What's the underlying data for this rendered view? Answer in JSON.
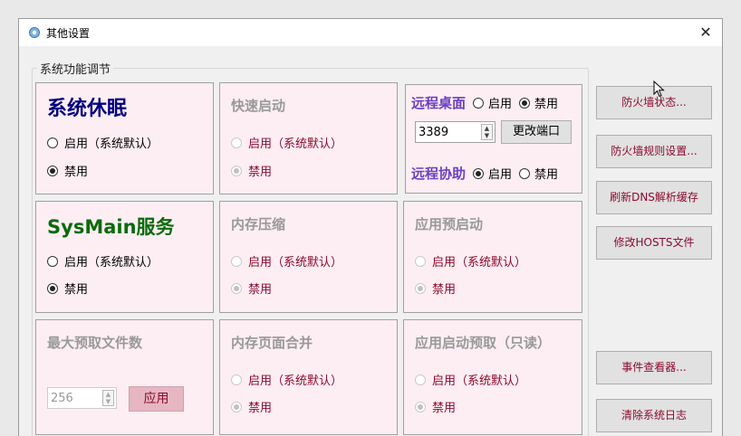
{
  "window": {
    "title": "其他设置",
    "close_glyph": "✕"
  },
  "group": {
    "label": "系统功能调节"
  },
  "panels": {
    "sleep": {
      "title": "系统休眠",
      "opt_enable": "启用（系统默认）",
      "opt_disable": "禁用"
    },
    "fast_boot": {
      "title": "快速启动",
      "opt_enable": "启用（系统默认）",
      "opt_disable": "禁用"
    },
    "remote": {
      "desktop_label": "远程桌面",
      "assist_label": "远程协助",
      "opt_enable": "启用",
      "opt_disable": "禁用",
      "port_value": "3389",
      "change_port": "更改端口"
    },
    "sysmain": {
      "title": "SysMain服务",
      "opt_enable": "启用（系统默认）",
      "opt_disable": "禁用"
    },
    "mem_compress": {
      "title": "内存压缩",
      "opt_enable": "启用（系统默认）",
      "opt_disable": "禁用"
    },
    "app_prelaunch": {
      "title": "应用预启动",
      "opt_enable": "启用（系统默认）",
      "opt_disable": "禁用"
    },
    "max_prefetch": {
      "title": "最大预取文件数",
      "value": "256",
      "apply": "应用"
    },
    "page_combine": {
      "title": "内存页面合并",
      "opt_enable": "启用（系统默认）",
      "opt_disable": "禁用"
    },
    "launch_prefetch": {
      "title": "应用启动预取（只读）",
      "opt_enable": "启用（系统默认）",
      "opt_disable": "禁用"
    }
  },
  "side_buttons": {
    "firewall_state": "防火墙状态...",
    "firewall_rules": "防火墙规则设置...",
    "flush_dns": "刷新DNS解析缓存",
    "edit_hosts": "修改HOSTS文件",
    "event_viewer": "事件查看器...",
    "clear_logs": "清除系统日志"
  }
}
